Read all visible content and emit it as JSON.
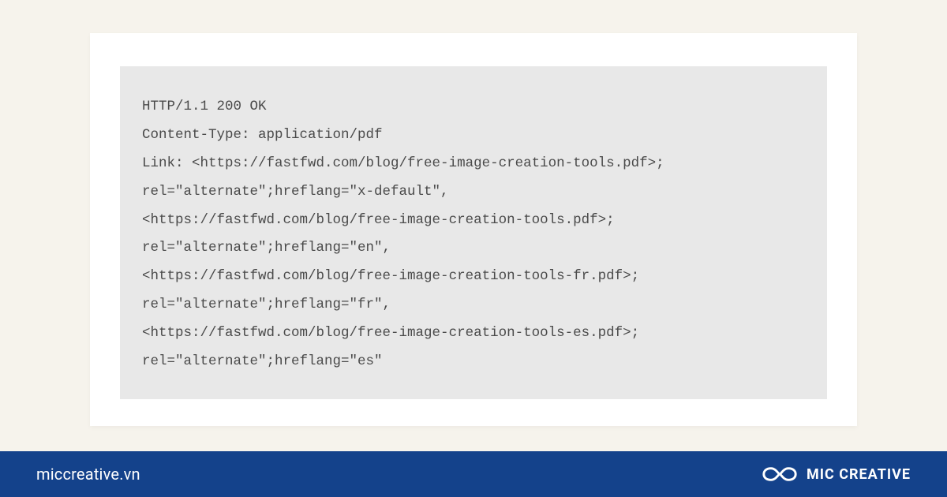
{
  "code": {
    "lines": [
      "HTTP/1.1 200 OK",
      "Content-Type: application/pdf",
      "Link: <https://fastfwd.com/blog/free-image-creation-tools.pdf>;",
      "rel=\"alternate\";hreflang=\"x-default\",",
      "<https://fastfwd.com/blog/free-image-creation-tools.pdf>;",
      "rel=\"alternate\";hreflang=\"en\",",
      "<https://fastfwd.com/blog/free-image-creation-tools-fr.pdf>;",
      "rel=\"alternate\";hreflang=\"fr\",",
      "<https://fastfwd.com/blog/free-image-creation-tools-es.pdf>;",
      "rel=\"alternate\";hreflang=\"es\""
    ]
  },
  "footer": {
    "url": "miccreative.vn",
    "brand": "MIC CREATIVE"
  },
  "colors": {
    "footer_bg": "#14428b",
    "code_bg": "#e8e8e8",
    "card_bg": "#ffffff",
    "page_bg": "#f6f3ec"
  }
}
